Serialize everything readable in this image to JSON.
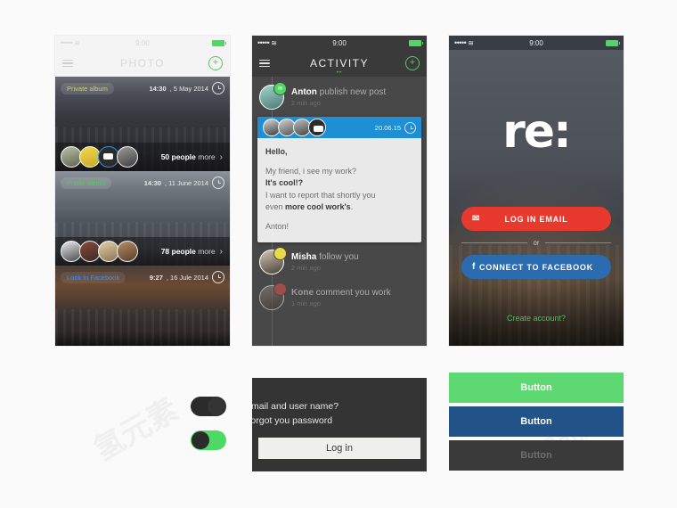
{
  "background": "#fafafa",
  "colors": {
    "green": "#4cd964",
    "blue": "#1e8fd5",
    "red": "#e8392e",
    "facebook_blue": "#2b6cb0",
    "dark": "#3a3a3a"
  },
  "phone1": {
    "status": {
      "signal": "•••••",
      "wifi": "≋",
      "time": "9:00"
    },
    "nav": {
      "menu_icon": "hamburger-icon",
      "title": "PHOTO",
      "add_icon": "plus-icon",
      "add_label": "+"
    },
    "albums": [
      {
        "tag": "Private album",
        "tag_type": "private",
        "time_bold": "14:30",
        "time_rest": ", 5 May 2014",
        "people_count": "50 people",
        "people_more": "more",
        "chevron": "›"
      },
      {
        "tag": "Public album",
        "tag_type": "public",
        "time_bold": "14:30",
        "time_rest": ", 11 June 2014",
        "people_count": "78 people",
        "people_more": "more",
        "chevron": "›"
      },
      {
        "tag": "Look in Facebook",
        "tag_type": "facebook",
        "time_bold": "9:27",
        "time_rest": ", 16 Jule 2014",
        "people_count": "",
        "people_more": "",
        "chevron": ""
      }
    ]
  },
  "phone2": {
    "status": {
      "signal": "•••••",
      "wifi": "≋",
      "time": "9:00"
    },
    "nav": {
      "menu_icon": "hamburger-icon",
      "title": "ACTIVITY",
      "add_label": "+",
      "page_dots": "••"
    },
    "feed_top": {
      "name": "Anton",
      "action": "publish new post",
      "time": "2 min ago",
      "badge_icon": "envelope-icon",
      "badge_glyph": "✉"
    },
    "post": {
      "date": "20.06.15",
      "line1": "Hello,",
      "line2": "My friend, i see my work?",
      "line3": "It's cool!?",
      "line4a": "I want to report that shortly you",
      "line4b": "even ",
      "line4c": "more cool work's",
      "line4d": ".",
      "signature": "Anton!"
    },
    "feed_items": [
      {
        "name": "Misha",
        "action": "follow you",
        "time": "2 min ago",
        "badge": "yellow"
      },
      {
        "name": "Kone",
        "action": "comment you work",
        "time": "1 min ago",
        "badge": "red"
      }
    ]
  },
  "phone3": {
    "status": {
      "signal": "•••••",
      "wifi": "≋",
      "time": "9:00"
    },
    "logo": "re:",
    "login_email": {
      "label": "LOG IN EMAIL",
      "icon": "envelope-icon",
      "glyph": "✉"
    },
    "divider": "or",
    "login_facebook": {
      "label": "CONNECT TO FACEBOOK",
      "icon": "facebook-icon",
      "glyph": "f"
    },
    "create_account": "Create account?"
  },
  "toggles": [
    {
      "state": "off",
      "name": "toggle-off"
    },
    {
      "state": "on",
      "name": "toggle-on"
    }
  ],
  "login_card": {
    "line1": "Email and user name?",
    "line2": "Forgot you password",
    "button": "Log in"
  },
  "buttons": [
    {
      "label": "Button",
      "style": "green"
    },
    {
      "label": "Button",
      "style": "blue"
    },
    {
      "label": "Button",
      "style": "gray"
    }
  ]
}
